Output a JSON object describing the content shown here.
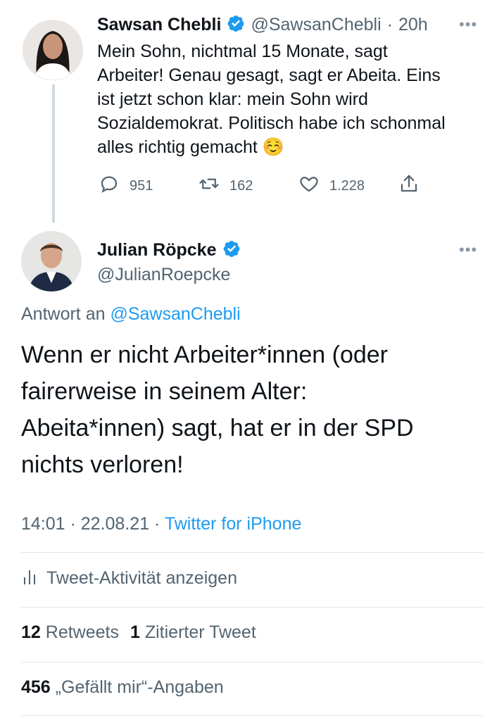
{
  "parent_tweet": {
    "name": "Sawsan Chebli",
    "handle": "@SawsanChebli",
    "separator": "·",
    "time": "20h",
    "text": "Mein Sohn, nichtmal 15 Monate, sagt\nArbeiter! Genau gesagt, sagt er Abeita. Eins\nist jetzt schon klar: mein Sohn wird\nSozialdemokrat. Politisch habe ich schonmal\nalles richtig gemacht",
    "emoji": "☺️",
    "replies": "951",
    "retweets": "162",
    "likes": "1.228"
  },
  "reply_tweet": {
    "name": "Julian Röpcke",
    "handle": "@JulianRoepcke",
    "reply_prefix": "Antwort an",
    "reply_to": "@SawsanChebli",
    "text": "Wenn er nicht Arbeiter*innen (oder\nfairerweise in seinem Alter:\nAbeita*innen) sagt, hat er in der SPD\nnichts verloren!",
    "timestamp": "14:01 · 22.08.21 · ",
    "source": "Twitter for iPhone",
    "activity_label": "Tweet-Aktivität anzeigen",
    "retweets_count": "12",
    "retweets_label": "Retweets",
    "quotes_count": "1",
    "quotes_label": "Zitierter Tweet",
    "likes_count": "456",
    "likes_label": "„Gefällt mir“-Angaben"
  },
  "icons": {
    "more": "more-icon",
    "verified": "verified-icon",
    "reply": "reply-icon",
    "retweet": "retweet-icon",
    "like": "heart-icon",
    "share": "share-icon",
    "activity": "bar-chart-icon"
  },
  "colors": {
    "accent": "#1d9bf0",
    "text": "#0f1419",
    "muted": "#536471"
  }
}
